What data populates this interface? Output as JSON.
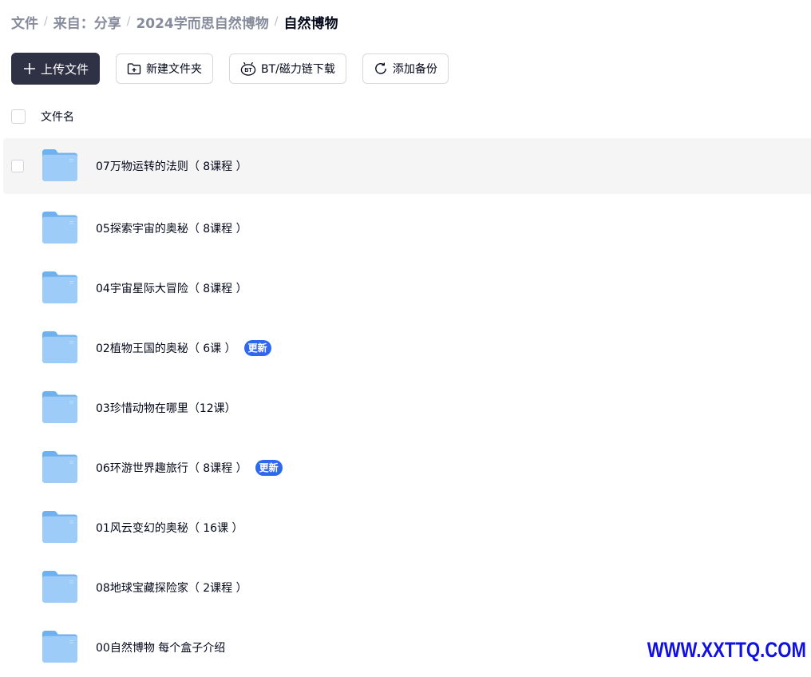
{
  "breadcrumb": {
    "items": [
      "文件",
      "来自：分享",
      "2024学而思自然博物"
    ],
    "current": "自然博物",
    "separator": "/"
  },
  "toolbar": {
    "upload_label": "上传文件",
    "new_folder_label": "新建文件夹",
    "bt_label": "BT/磁力链下载",
    "backup_label": "添加备份",
    "upload_icon": "plus-icon",
    "new_folder_icon": "folder-plus-icon",
    "bt_icon": "bt-icon",
    "backup_icon": "refresh-icon"
  },
  "list": {
    "header_label": "文件名",
    "rows": [
      {
        "name": "07万物运转的法则（ 8课程 ）",
        "badge": "",
        "hovered": true
      },
      {
        "name": "05探索宇宙的奥秘（ 8课程 ）",
        "badge": ""
      },
      {
        "name": "04宇宙星际大冒险（ 8课程 ）",
        "badge": ""
      },
      {
        "name": "02植物王国的奥秘（ 6课 ）",
        "badge": "更新"
      },
      {
        "name": "03珍惜动物在哪里（12课）",
        "badge": ""
      },
      {
        "name": "06环游世界趣旅行（ 8课程 ）",
        "badge": "更新"
      },
      {
        "name": "01风云变幻的奥秘（ 16课 ）",
        "badge": ""
      },
      {
        "name": "08地球宝藏探险家（ 2课程 ）",
        "badge": ""
      },
      {
        "name": "00自然博物 每个盒子介绍",
        "badge": ""
      }
    ]
  },
  "colors": {
    "primary_button": "#2f3244",
    "badge": "#2f68f0",
    "folder": "#8cc4f7",
    "watermark": "#1010e6"
  },
  "watermark": "WWW.XXTTQ.COM"
}
